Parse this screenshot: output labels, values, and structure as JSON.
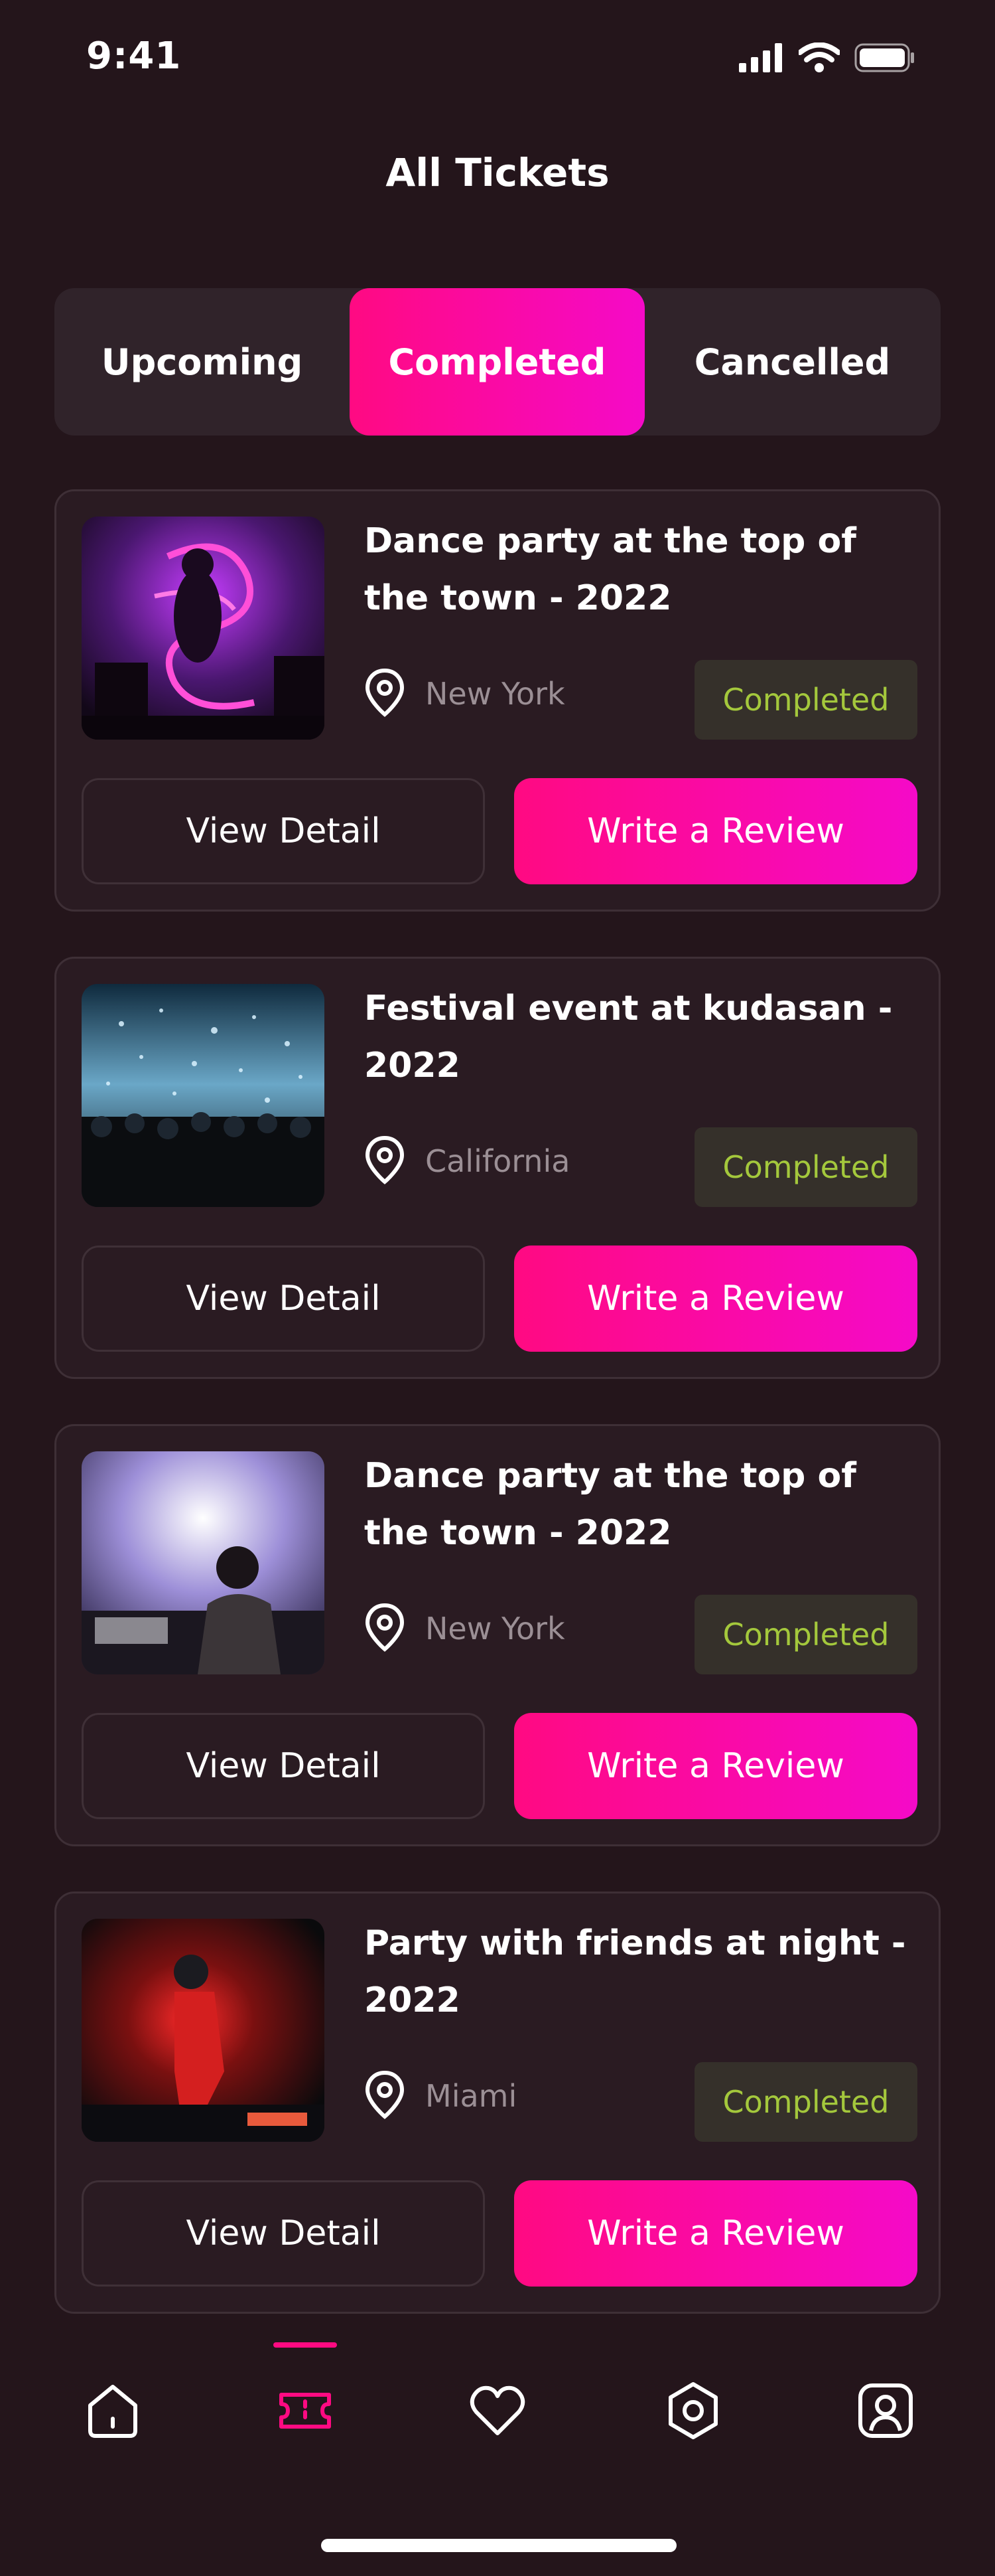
{
  "status_bar": {
    "time": "9:41"
  },
  "header": {
    "title": "All Tickets"
  },
  "tabs": [
    {
      "label": "Upcoming",
      "active": false
    },
    {
      "label": "Completed",
      "active": true
    },
    {
      "label": "Cancelled",
      "active": false
    }
  ],
  "tickets": [
    {
      "title": "Dance party at the top of the town - 2022",
      "location": "New York",
      "status": "Completed",
      "view_label": "View Detail",
      "review_label": "Write a Review"
    },
    {
      "title": "Festival event at kudasan - 2022",
      "location": "California",
      "status": "Completed",
      "view_label": "View Detail",
      "review_label": "Write a Review"
    },
    {
      "title": "Dance party at the top of the town - 2022",
      "location": "New York",
      "status": "Completed",
      "view_label": "View Detail",
      "review_label": "Write a Review"
    },
    {
      "title": "Party with friends at night - 2022",
      "location": "Miami",
      "status": "Completed",
      "view_label": "View Detail",
      "review_label": "Write a Review"
    }
  ],
  "bottom_nav": [
    {
      "icon": "home-icon",
      "active": false
    },
    {
      "icon": "ticket-icon",
      "active": true
    },
    {
      "icon": "heart-icon",
      "active": false
    },
    {
      "icon": "settings-icon",
      "active": false
    },
    {
      "icon": "profile-icon",
      "active": false
    }
  ],
  "colors": {
    "accent": "#ff0a82",
    "background": "#24151b",
    "status_text": "#a4c83c"
  }
}
